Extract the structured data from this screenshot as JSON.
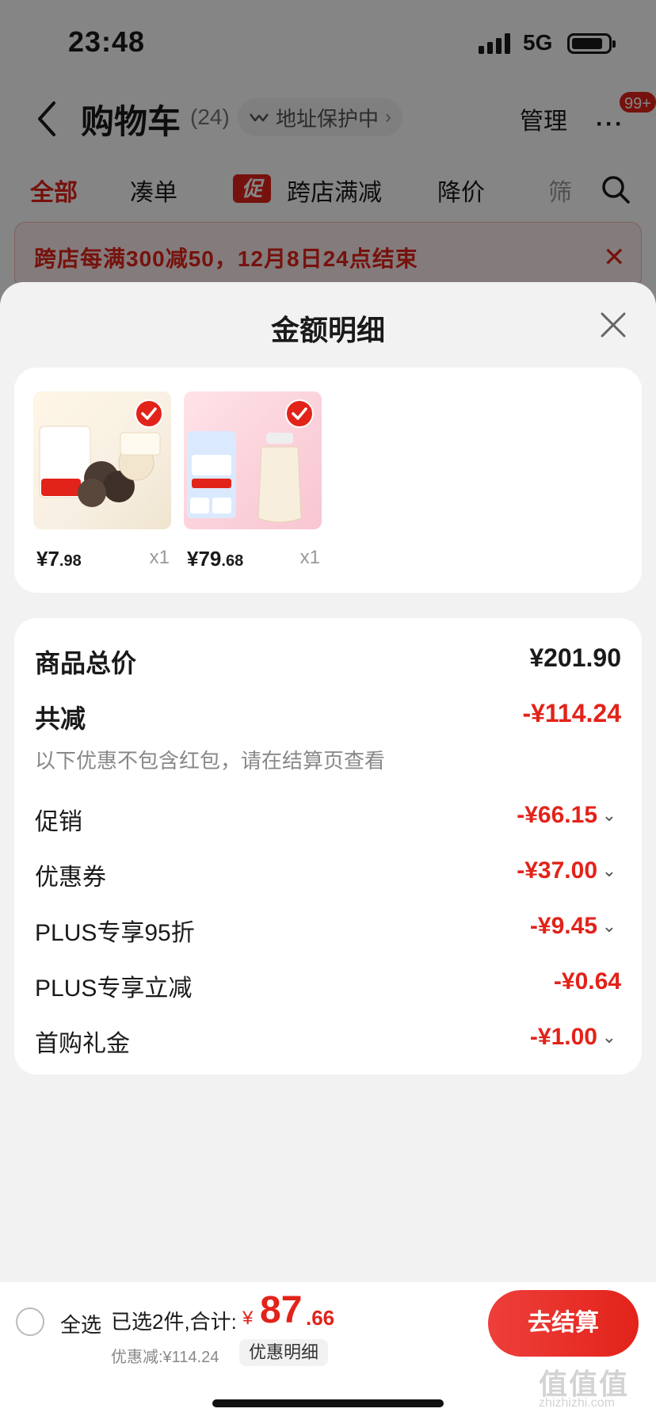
{
  "status_bar": {
    "time": "23:48",
    "network": "5G"
  },
  "header": {
    "title": "购物车",
    "count": "(24)",
    "address_protect": "地址保护中",
    "manage": "管理",
    "more_badge": "99+"
  },
  "tabs": [
    {
      "label": "全部"
    },
    {
      "label": "凑单"
    },
    {
      "label": "跨店满减",
      "tag": "促"
    },
    {
      "label": "降价"
    },
    {
      "label": "筛"
    }
  ],
  "promo_banner": {
    "text": "跨店每满300减50，12月8日24点结束"
  },
  "sheet": {
    "title": "金额明细",
    "products": [
      {
        "price_int": "¥7",
        "price_dec": ".98",
        "qty": "x1"
      },
      {
        "price_int": "¥79",
        "price_dec": ".68",
        "qty": "x1"
      }
    ],
    "total_label": "商品总价",
    "total_value": "¥201.90",
    "reduce_label": "共减",
    "reduce_value": "-¥114.24",
    "note": "以下优惠不包含红包，请在结算页查看",
    "items": [
      {
        "label": "促销",
        "value": "-¥66.15"
      },
      {
        "label": "优惠券",
        "value": "-¥37.00"
      },
      {
        "label": "PLUS专享95折",
        "value": "-¥9.45"
      },
      {
        "label": "PLUS专享立减",
        "value": "-¥0.64"
      },
      {
        "label": "首购礼金",
        "value": "-¥1.00"
      }
    ]
  },
  "bottom": {
    "select_all": "全选",
    "summary_label": "已选2件,合计:",
    "yen": "¥",
    "total_int": "87",
    "total_dec": ".66",
    "discount": "优惠减:¥114.24",
    "detail_pill": "优惠明细",
    "checkout": "去结算"
  },
  "watermark": {
    "main": "值值值",
    "sub": "zhizhizhi.com"
  },
  "colors": {
    "accent": "#e2231a",
    "sheet_bg": "#f2f2f2",
    "card_bg": "#ffffff"
  }
}
